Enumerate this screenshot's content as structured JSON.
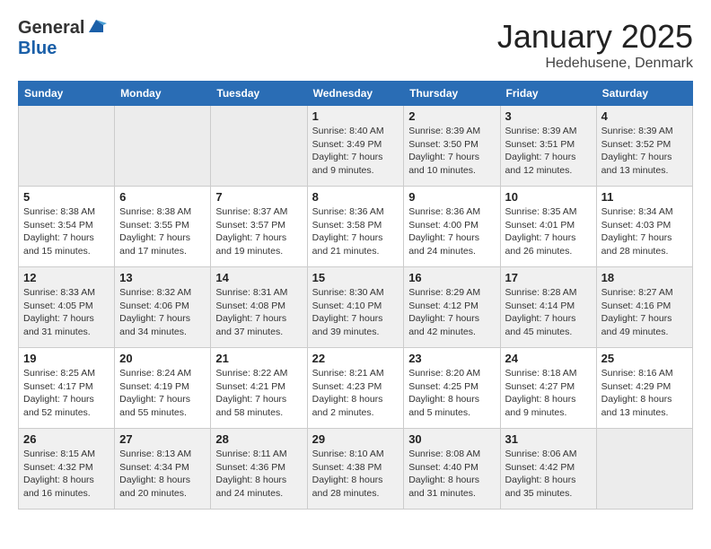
{
  "logo": {
    "general": "General",
    "blue": "Blue"
  },
  "title": "January 2025",
  "location": "Hedehusene, Denmark",
  "weekdays": [
    "Sunday",
    "Monday",
    "Tuesday",
    "Wednesday",
    "Thursday",
    "Friday",
    "Saturday"
  ],
  "weeks": [
    [
      {
        "day": "",
        "info": ""
      },
      {
        "day": "",
        "info": ""
      },
      {
        "day": "",
        "info": ""
      },
      {
        "day": "1",
        "info": "Sunrise: 8:40 AM\nSunset: 3:49 PM\nDaylight: 7 hours\nand 9 minutes."
      },
      {
        "day": "2",
        "info": "Sunrise: 8:39 AM\nSunset: 3:50 PM\nDaylight: 7 hours\nand 10 minutes."
      },
      {
        "day": "3",
        "info": "Sunrise: 8:39 AM\nSunset: 3:51 PM\nDaylight: 7 hours\nand 12 minutes."
      },
      {
        "day": "4",
        "info": "Sunrise: 8:39 AM\nSunset: 3:52 PM\nDaylight: 7 hours\nand 13 minutes."
      }
    ],
    [
      {
        "day": "5",
        "info": "Sunrise: 8:38 AM\nSunset: 3:54 PM\nDaylight: 7 hours\nand 15 minutes."
      },
      {
        "day": "6",
        "info": "Sunrise: 8:38 AM\nSunset: 3:55 PM\nDaylight: 7 hours\nand 17 minutes."
      },
      {
        "day": "7",
        "info": "Sunrise: 8:37 AM\nSunset: 3:57 PM\nDaylight: 7 hours\nand 19 minutes."
      },
      {
        "day": "8",
        "info": "Sunrise: 8:36 AM\nSunset: 3:58 PM\nDaylight: 7 hours\nand 21 minutes."
      },
      {
        "day": "9",
        "info": "Sunrise: 8:36 AM\nSunset: 4:00 PM\nDaylight: 7 hours\nand 24 minutes."
      },
      {
        "day": "10",
        "info": "Sunrise: 8:35 AM\nSunset: 4:01 PM\nDaylight: 7 hours\nand 26 minutes."
      },
      {
        "day": "11",
        "info": "Sunrise: 8:34 AM\nSunset: 4:03 PM\nDaylight: 7 hours\nand 28 minutes."
      }
    ],
    [
      {
        "day": "12",
        "info": "Sunrise: 8:33 AM\nSunset: 4:05 PM\nDaylight: 7 hours\nand 31 minutes."
      },
      {
        "day": "13",
        "info": "Sunrise: 8:32 AM\nSunset: 4:06 PM\nDaylight: 7 hours\nand 34 minutes."
      },
      {
        "day": "14",
        "info": "Sunrise: 8:31 AM\nSunset: 4:08 PM\nDaylight: 7 hours\nand 37 minutes."
      },
      {
        "day": "15",
        "info": "Sunrise: 8:30 AM\nSunset: 4:10 PM\nDaylight: 7 hours\nand 39 minutes."
      },
      {
        "day": "16",
        "info": "Sunrise: 8:29 AM\nSunset: 4:12 PM\nDaylight: 7 hours\nand 42 minutes."
      },
      {
        "day": "17",
        "info": "Sunrise: 8:28 AM\nSunset: 4:14 PM\nDaylight: 7 hours\nand 45 minutes."
      },
      {
        "day": "18",
        "info": "Sunrise: 8:27 AM\nSunset: 4:16 PM\nDaylight: 7 hours\nand 49 minutes."
      }
    ],
    [
      {
        "day": "19",
        "info": "Sunrise: 8:25 AM\nSunset: 4:17 PM\nDaylight: 7 hours\nand 52 minutes."
      },
      {
        "day": "20",
        "info": "Sunrise: 8:24 AM\nSunset: 4:19 PM\nDaylight: 7 hours\nand 55 minutes."
      },
      {
        "day": "21",
        "info": "Sunrise: 8:22 AM\nSunset: 4:21 PM\nDaylight: 7 hours\nand 58 minutes."
      },
      {
        "day": "22",
        "info": "Sunrise: 8:21 AM\nSunset: 4:23 PM\nDaylight: 8 hours\nand 2 minutes."
      },
      {
        "day": "23",
        "info": "Sunrise: 8:20 AM\nSunset: 4:25 PM\nDaylight: 8 hours\nand 5 minutes."
      },
      {
        "day": "24",
        "info": "Sunrise: 8:18 AM\nSunset: 4:27 PM\nDaylight: 8 hours\nand 9 minutes."
      },
      {
        "day": "25",
        "info": "Sunrise: 8:16 AM\nSunset: 4:29 PM\nDaylight: 8 hours\nand 13 minutes."
      }
    ],
    [
      {
        "day": "26",
        "info": "Sunrise: 8:15 AM\nSunset: 4:32 PM\nDaylight: 8 hours\nand 16 minutes."
      },
      {
        "day": "27",
        "info": "Sunrise: 8:13 AM\nSunset: 4:34 PM\nDaylight: 8 hours\nand 20 minutes."
      },
      {
        "day": "28",
        "info": "Sunrise: 8:11 AM\nSunset: 4:36 PM\nDaylight: 8 hours\nand 24 minutes."
      },
      {
        "day": "29",
        "info": "Sunrise: 8:10 AM\nSunset: 4:38 PM\nDaylight: 8 hours\nand 28 minutes."
      },
      {
        "day": "30",
        "info": "Sunrise: 8:08 AM\nSunset: 4:40 PM\nDaylight: 8 hours\nand 31 minutes."
      },
      {
        "day": "31",
        "info": "Sunrise: 8:06 AM\nSunset: 4:42 PM\nDaylight: 8 hours\nand 35 minutes."
      },
      {
        "day": "",
        "info": ""
      }
    ]
  ]
}
